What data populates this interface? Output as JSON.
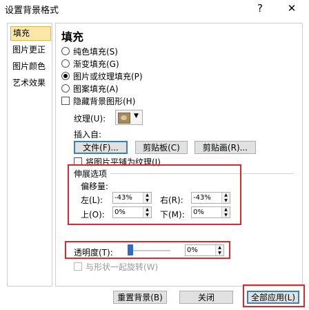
{
  "window": {
    "title": "设置背景格式",
    "help_glyph": "?",
    "close_glyph": "✕"
  },
  "sidebar": {
    "items": [
      {
        "label": "填充"
      },
      {
        "label": "图片更正"
      },
      {
        "label": "图片颜色"
      },
      {
        "label": "艺术效果"
      }
    ]
  },
  "fill": {
    "heading": "填充",
    "options": [
      {
        "label": "纯色填充(S)",
        "selected": false
      },
      {
        "label": "渐变填充(G)",
        "selected": false
      },
      {
        "label": "图片或纹理填充(P)",
        "selected": true
      },
      {
        "label": "图案填充(A)",
        "selected": false
      }
    ],
    "hide_bg_label": "隐藏背景图形(H)",
    "texture_label": "纹理(U):",
    "insert_from_label": "插入自:",
    "file_button": "文件(F)...",
    "clipboard_button": "剪贴板(C)",
    "clipart_button": "剪贴画(R)...",
    "tile_label": "将图片平铺为纹理(I)"
  },
  "stretch": {
    "heading": "伸展选项",
    "offset_label": "偏移量:",
    "left_label": "左(L):",
    "left_value": "-43%",
    "right_label": "右(R):",
    "right_value": "-43%",
    "top_label": "上(O):",
    "top_value": "0%",
    "bottom_label": "下(M):",
    "bottom_value": "0%"
  },
  "transparency": {
    "label": "透明度(T):",
    "value": "0%",
    "level_percent": 0
  },
  "rotate_label": "与形状一起旋转(W)",
  "footer": {
    "reset_button": "重置背景(B)",
    "close_button": "关闭",
    "apply_all_button": "全部应用(L)"
  },
  "colors": {
    "highlight_box": "#e0262b",
    "active_tab": "#fde7a8",
    "slider_thumb": "#2b6cc4"
  }
}
